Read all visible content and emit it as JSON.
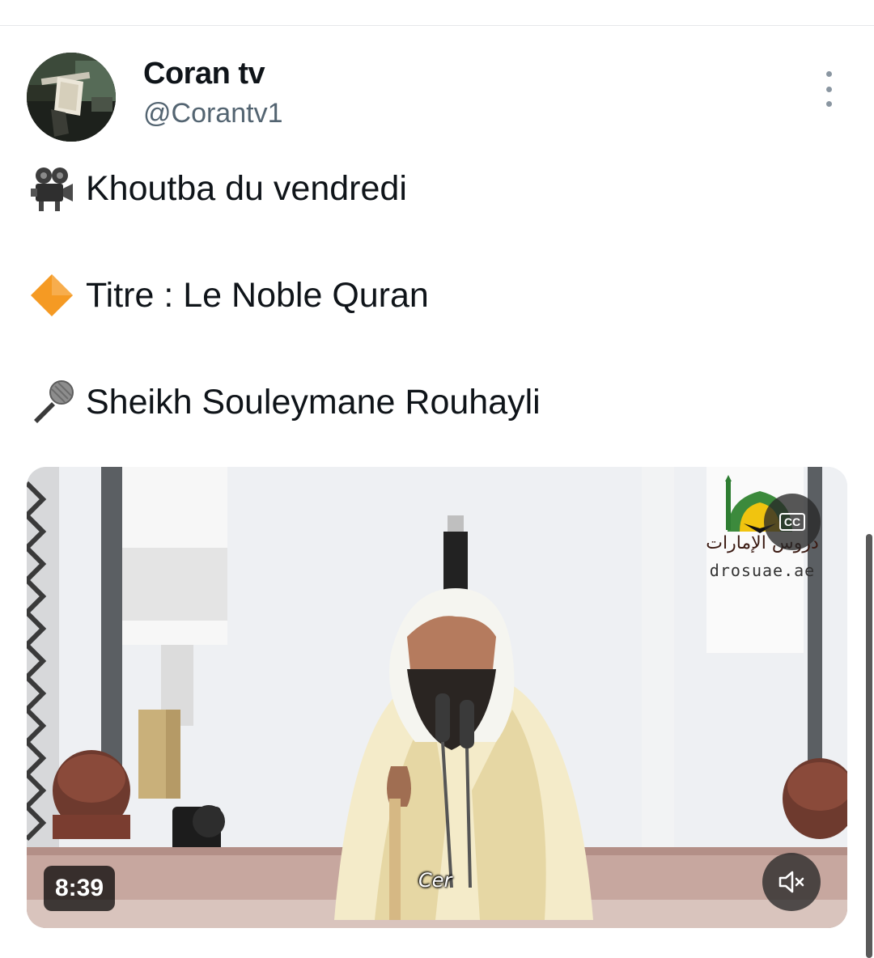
{
  "author": {
    "display_name": "Coran tv",
    "handle": "@Corantv1"
  },
  "tweet": {
    "lines": [
      {
        "icon": "movie-camera-icon",
        "text": "Khoutba du vendredi"
      },
      {
        "icon": "orange-diamond-icon",
        "text": "Titre : Le Noble Quran"
      },
      {
        "icon": "microphone-icon",
        "text": "Sheikh Souleymane Rouhayli"
      }
    ]
  },
  "video": {
    "duration": "8:39",
    "caption_button": "CC",
    "subtitle_text": "Cer",
    "watermark_arabic": "دروس الإمارات",
    "watermark_url": "drosuae.ae",
    "muted": true
  },
  "colors": {
    "text_primary": "#0f1419",
    "text_secondary": "#536471",
    "overlay": "#282828"
  }
}
